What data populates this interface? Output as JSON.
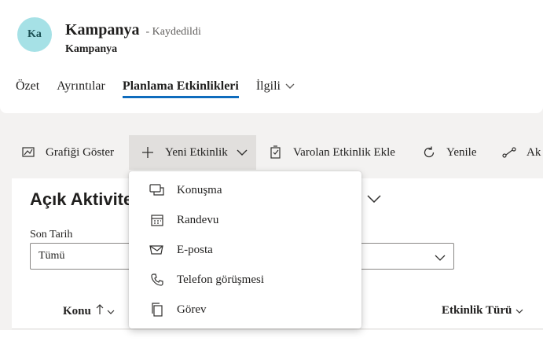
{
  "header": {
    "avatar_initials": "Ka",
    "title": "Kampanya",
    "saved_status": "- Kaydedildi",
    "entity_type": "Kampanya",
    "tabs": [
      {
        "label": "Özet"
      },
      {
        "label": "Ayrıntılar"
      },
      {
        "label": "Planlama Etkinlikleri",
        "active": true
      },
      {
        "label": "İlgili"
      }
    ]
  },
  "toolbar": {
    "show_chart": "Grafiği Göster",
    "new_activity": "Yeni Etkinlik",
    "add_existing": "Varolan Etkinlik Ekle",
    "refresh": "Yenile",
    "more": "Ak"
  },
  "panel": {
    "title": "Açık Aktivite",
    "filter_label": "Son Tarih",
    "filter_value": "Tümü"
  },
  "grid": {
    "columns": [
      "Konu",
      "Etkinlik Türü"
    ]
  },
  "dropdown": {
    "items": [
      {
        "label": "Konuşma",
        "icon": "conversation-icon"
      },
      {
        "label": "Randevu",
        "icon": "calendar-icon"
      },
      {
        "label": "E-posta",
        "icon": "email-icon"
      },
      {
        "label": "Telefon görüşmesi",
        "icon": "phone-icon"
      },
      {
        "label": "Görev",
        "icon": "task-icon"
      }
    ]
  },
  "colors": {
    "accent": "#0f6cbd",
    "avatar_bg": "#a6e1e6",
    "background": "#f3f2f1"
  }
}
